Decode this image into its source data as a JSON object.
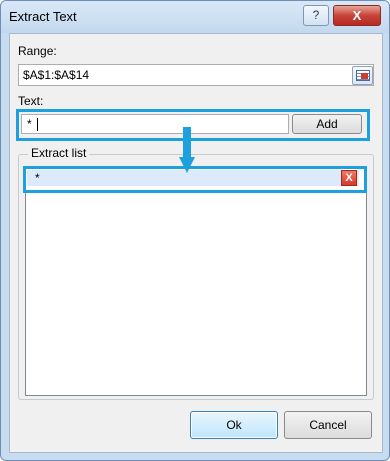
{
  "window": {
    "title": "Extract Text",
    "help_label": "?",
    "close_label": "X"
  },
  "range": {
    "label": "Range:",
    "value": "$A$1:$A$14",
    "picker_icon": "range-select-icon"
  },
  "text": {
    "label": "Text:",
    "value": "*",
    "add_label": "Add"
  },
  "extract_list": {
    "label": "Extract list",
    "items": [
      {
        "text": "*",
        "delete_label": "X"
      }
    ]
  },
  "footer": {
    "ok_label": "Ok",
    "cancel_label": "Cancel"
  },
  "colors": {
    "highlight": "#1ea0df",
    "close_red": "#c7443a",
    "selected_row": "#dcebfc"
  }
}
